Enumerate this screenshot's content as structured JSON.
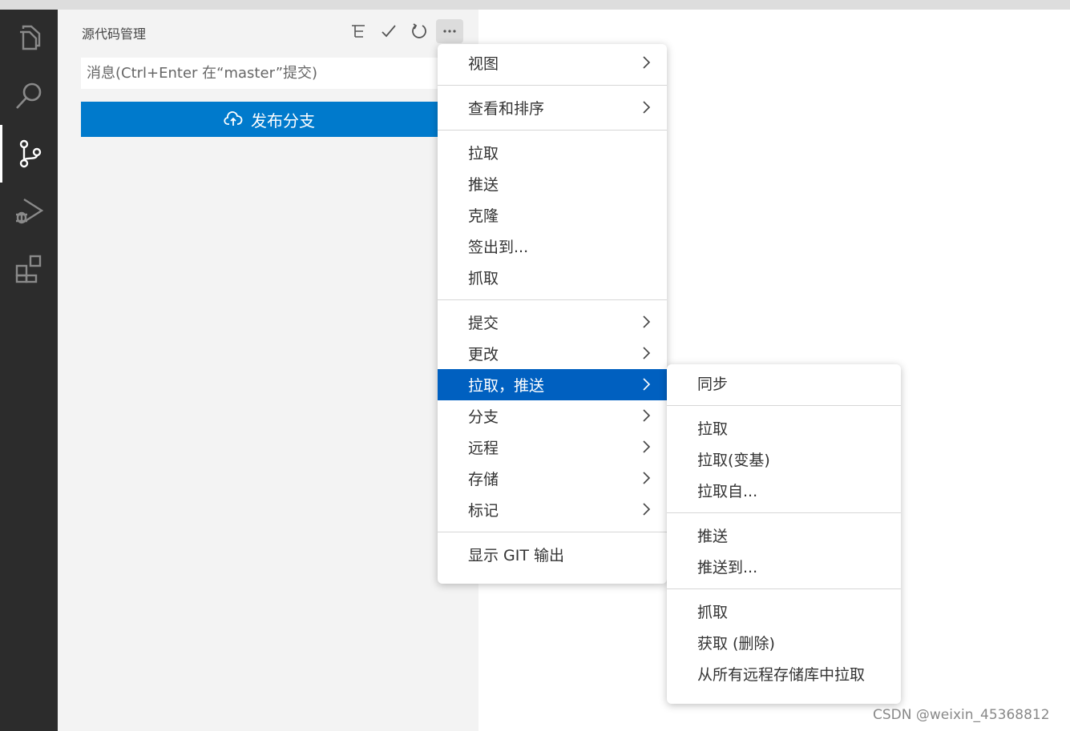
{
  "sidebar": {
    "title": "源代码管理",
    "commit_placeholder": "消息(Ctrl+Enter 在“master”提交)",
    "publish_label": "发布分支"
  },
  "activity_bar": {
    "icons": [
      "explorer-icon",
      "search-icon",
      "source-control-icon",
      "run-debug-icon",
      "extensions-icon"
    ],
    "active": "source-control-icon"
  },
  "sidebar_actions": [
    "tree-view-icon",
    "check-icon",
    "refresh-icon",
    "more-icon"
  ],
  "menu": {
    "items": [
      {
        "label": "视图",
        "submenu": true
      },
      {
        "label": "查看和排序",
        "submenu": true
      },
      {
        "label": "拉取"
      },
      {
        "label": "推送"
      },
      {
        "label": "克隆"
      },
      {
        "label": "签出到..."
      },
      {
        "label": "抓取"
      },
      {
        "label": "提交",
        "submenu": true
      },
      {
        "label": "更改",
        "submenu": true
      },
      {
        "label": "拉取，推送",
        "submenu": true,
        "selected": true
      },
      {
        "label": "分支",
        "submenu": true
      },
      {
        "label": "远程",
        "submenu": true
      },
      {
        "label": "存储",
        "submenu": true
      },
      {
        "label": "标记",
        "submenu": true
      },
      {
        "label": "显示 GIT 输出"
      }
    ]
  },
  "submenu": {
    "items": [
      {
        "label": "同步"
      },
      {
        "label": "拉取"
      },
      {
        "label": "拉取(变基)"
      },
      {
        "label": "拉取自..."
      },
      {
        "label": "推送"
      },
      {
        "label": "推送到..."
      },
      {
        "label": "抓取"
      },
      {
        "label": "获取 (删除)"
      },
      {
        "label": "从所有远程存储库中拉取"
      }
    ]
  },
  "watermark": "CSDN @weixin_45368812",
  "colors": {
    "activity_bar": "#2c2c2c",
    "sidebar": "#f3f3f3",
    "accent": "#007acc",
    "menu_selected": "#0060c0"
  }
}
